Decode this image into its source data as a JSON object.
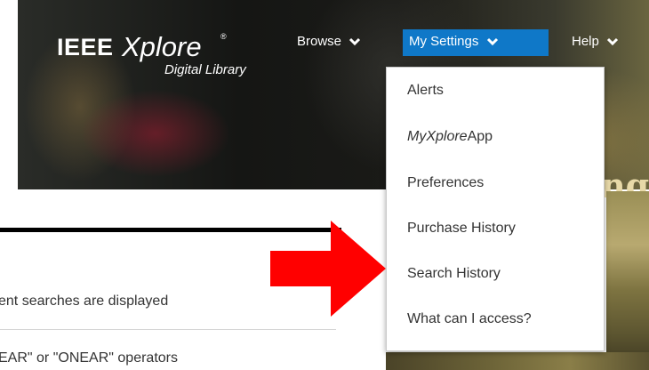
{
  "logo": {
    "brand": "IEEE",
    "product": "Xplore",
    "registered": "®",
    "subtitle": "Digital Library"
  },
  "nav": {
    "browse": "Browse",
    "my_settings": "My Settings",
    "help": "Help"
  },
  "menu": {
    "items": [
      "Alerts",
      "MyXploreApp",
      "Preferences",
      "Purchase History",
      "Search History",
      "What can I access?"
    ],
    "app_prefix": "My",
    "app_mid": "Xplore",
    "app_suffix": "App"
  },
  "banner_partial_text": "ng",
  "page_fragment": {
    "line1": "ent searches are displayed",
    "line2": "EAR\" or \"ONEAR\" operators"
  },
  "colors": {
    "nav_active_bg": "#0f78c8",
    "arrow": "#ff0000"
  },
  "icons": {
    "chevron": "chevron-down-icon",
    "arrow": "arrow-right-icon"
  }
}
